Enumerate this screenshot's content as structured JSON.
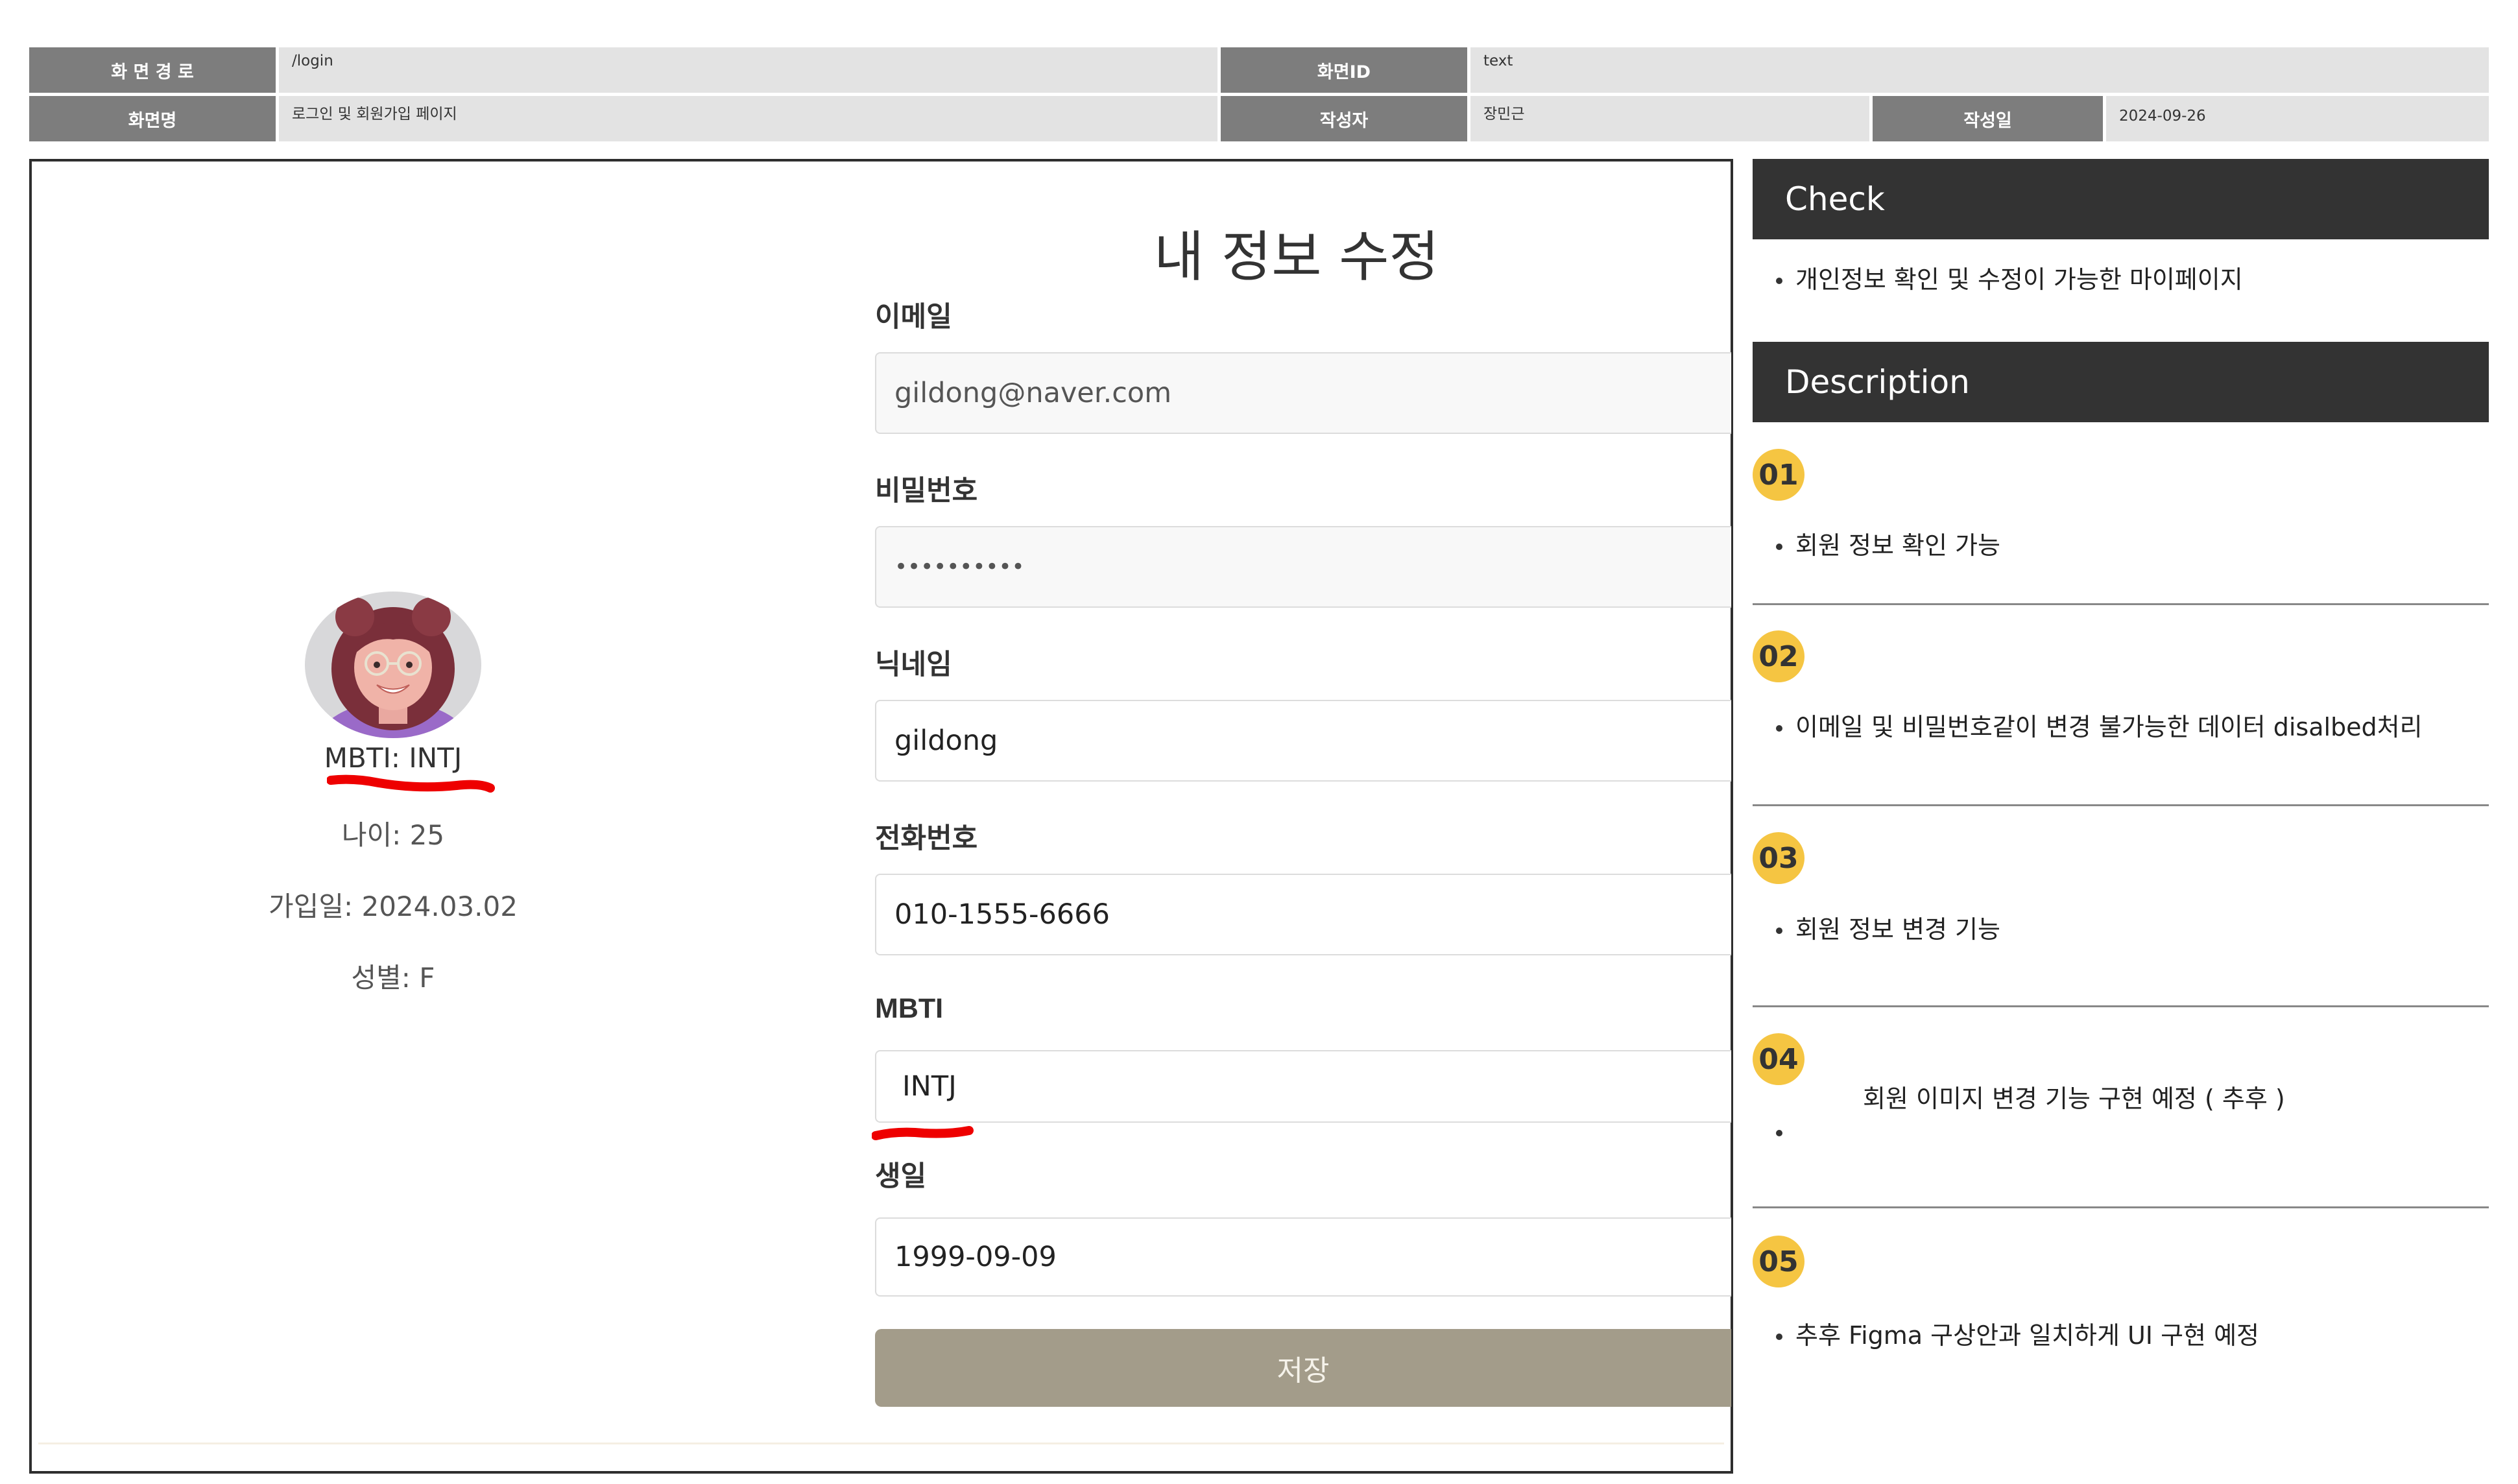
{
  "header": {
    "path_label": "화 면 경 로",
    "path_value": "/login",
    "screen_id_label": "화면ID",
    "screen_id_value": "text",
    "screen_name_label": "화면명",
    "screen_name_value": "로그인 및 회원가입 페이지",
    "author_label": "작성자",
    "author_value": "장민근",
    "date_label": "작성일",
    "date_value": "2024-09-26"
  },
  "screen": {
    "title": "내 정보 수정",
    "profile": {
      "mbti": "MBTI: INTJ",
      "age": "나이: 25",
      "joined": "가입일: 2024.03.02",
      "gender": "성별: F"
    },
    "fields": {
      "email_label": "이메일",
      "email_value": "gildong@naver.com",
      "password_label": "비밀번호",
      "password_value": "••••••••••",
      "nickname_label": "닉네임",
      "nickname_value": "gildong",
      "phone_label": "전화번호",
      "phone_value": "010-1555-6666",
      "mbti_label": "MBTI",
      "mbti_value": "INTJ",
      "birth_label": "생일",
      "birth_value": "1999-09-09"
    },
    "save_label": "저장"
  },
  "check": {
    "title": "Check",
    "items": [
      "개인정보 확인 및 수정이 가능한 마이페이지"
    ]
  },
  "description": {
    "title": "Description",
    "items": [
      {
        "num": "01",
        "text": "회원 정보 확인 가능"
      },
      {
        "num": "02",
        "text": "이메일 및 비밀번호같이 변경 불가능한 데이터 disalbed처리"
      },
      {
        "num": "03",
        "text": "회원 정보 변경 기능"
      },
      {
        "num": "04",
        "text": "회원 이미지  변경 기능 구현 예정 ( 추후 )"
      },
      {
        "num": "05",
        "text": "추후 Figma 구상안과 일치하게 UI 구현 예정"
      }
    ]
  },
  "colors": {
    "header_label_bg": "#7d7d7d",
    "header_value_bg": "#e3e3e3",
    "panel_header_bg": "#333333",
    "badge": "#f5c542",
    "save_button": "#a39c8a",
    "annotation_underline": "#ee0000"
  }
}
